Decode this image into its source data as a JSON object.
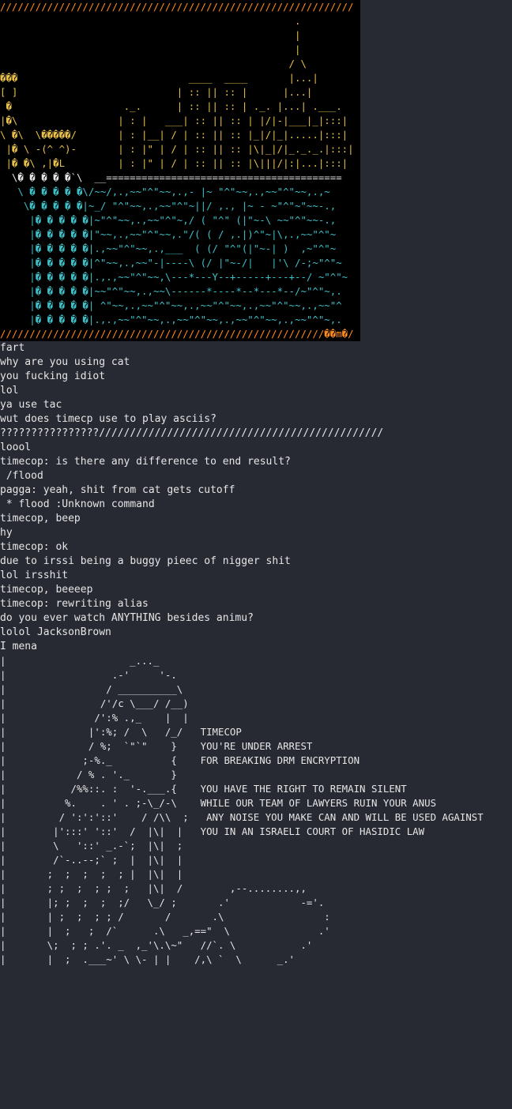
{
  "colors": {
    "background": "#272a33",
    "art_background": "#000000",
    "text": "#e6e6e6",
    "border_orange": "#ff8c1a",
    "yellow": "#e8c04a",
    "red": "#e03b3b",
    "cyan": "#3ec0c8",
    "blue": "#3a6df0"
  },
  "ascii_art": [
    "////////////////////////////////////////////////////////////",
    "                                                  .         ",
    "                                                  |         ",
    "                                                  |         ",
    "                                                 / \\        ",
    "���                             ____  ____       |...|      ",
    "[ ]                           | :: || :: |      |...|      ",
    " �                   ._.      | :: || :: | ._. |...| .___.  ",
    "|�\\                 | : |   ___| :: || :: | |/|-|___|_|:::|",
    "\\ �\\  \\�����/       | : |__| / | :: || :: |_|/|_|.....|:::|",
    " |� \\ -(^ ^)-       | : |\" | / | :: || :: |\\|_|/|_._._.|:::|",
    " |� �\\ ,|�L         | : |\" | / | :: || :: |\\|||/|:|...|:::|",
    "  \\� � � � �`\\  __========================================",
    "   \\ � � � � �\\/~~/,.,~~\"^\"~~,.,- |~ \"^\"~~,.,~~\"^\"~~,.,~",
    "    \\� � � � �|~_/ \"^\"~~,.,~~\"^\"~||/ ,., |~ - ~\"^\"~\"~~-.,",
    "     |� � � � �|~\"^\"~~,.,~~\"^\"~,/ ( \"^\" (|\"~-\\ ~~\"^\"~~-.,",
    "     |� � � � �|\"~~,.,~~\"^\"~~,.\"/( ( / ,.|)^\"~|\\,.,~~\"^\"~",
    "     |� � � � �|.,~~\"^\"~~,.,___  ( (/ \"^\"(|\"~-| )  ,~\"^\"~",
    "     |� � � � �|^\"~~,.,~~\"-|----\\ (/ |\"~-/|   |'\\ /-;~\"^\"~",
    "     |� � � � �|.,.,~~\"^\"~~,\\---*---Y--+-----+---+--/ ~\"^\"~",
    "     |� � � � �|~~\"^\"~~,.,~~\\------*----*--*---*--/~\"^\"~,.",
    "     |� � � � �| ^\"~~,.,~~\"^\"~~,.,~~\"^\"~~,.,~~\"^\"~~,.,~~\"^",
    "     |� � � � �|.,.,~~\"^\"~~,.,~~\"^\"~~,.,~~\"^\"~~,.,~~\"^\"~,.",
    "///////////////////////////////////////////////////////��m�/"
  ],
  "chat": [
    "fart",
    "why are you using cat",
    "you fucking idiot",
    "lol",
    "ya use tac",
    "wut does timecp use to play asciis?",
    "????????????????//////////////////////////////////////////////",
    "loool",
    "timecop: is there any difference to end result?",
    " /flood",
    "pagga: yeah, shit from cat gets cutoff",
    " * flood :Unknown command",
    "timecop, beep",
    "hy",
    "timecop: ok",
    "due to irssi being a buggy pieec of nigger shit",
    "lol irsshit",
    "timecop, beeeep",
    "timecop: rewriting alias",
    "do you ever watch ANYTHING besides animu?",
    "lolol JacksonBrown",
    "I mena"
  ],
  "timecop_art": [
    "|                     _..._",
    "|                  .-'     '-.",
    "|                 / __________\\",
    "|                /'/c \\___/ /__)",
    "|               /':% .,_    |  |",
    "|              |':%; /  \\   /_/   TIMECOP",
    "|              / %;  `\"`\"    }    YOU'RE UNDER ARREST",
    "|             ;-%._          {    FOR BREAKING DRM ENCRYPTION",
    "|            / % . '._       }",
    "|           /%%::. :  '-.___.{    YOU HAVE THE RIGHT TO REMAIN SILENT",
    "|          %.    . ' . ;-\\_/-\\    WHILE OUR TEAM OF LAWYERS RUIN YOUR ANUS",
    "|         / ':':'::'    / /\\\\  ;   ANY NOISE YOU MAKE CAN AND WILL BE USED AGAINST",
    "|        |':::' '::'  /  |\\|  |   YOU IN AN ISRAELI COURT OF HASIDIC LAW",
    "|        \\   '::' _.-`;  |\\|  ;",
    "|        /`-..--;` ;  |  |\\|  |",
    "|       ;  ;  ;  ;  ; |  |\\|  |",
    "|       ; ;  ;  ; ;  ;   |\\|  /        ,--........,,",
    "|       |; ;  ;  ;  ;/   \\_/ ;       .'            -='.",
    "|       | ;  ;  ; ; /       /       .\\                 :",
    "|       |  ;   ;  /`      .\\   _,==\"  \\               .'",
    "|       \\;  ; ; .'. _  ,_'\\.\\~\"   //`. \\           .'",
    "|       |  ;  .___~' \\ \\- | |    /,\\ `  \\      _.'"
  ]
}
